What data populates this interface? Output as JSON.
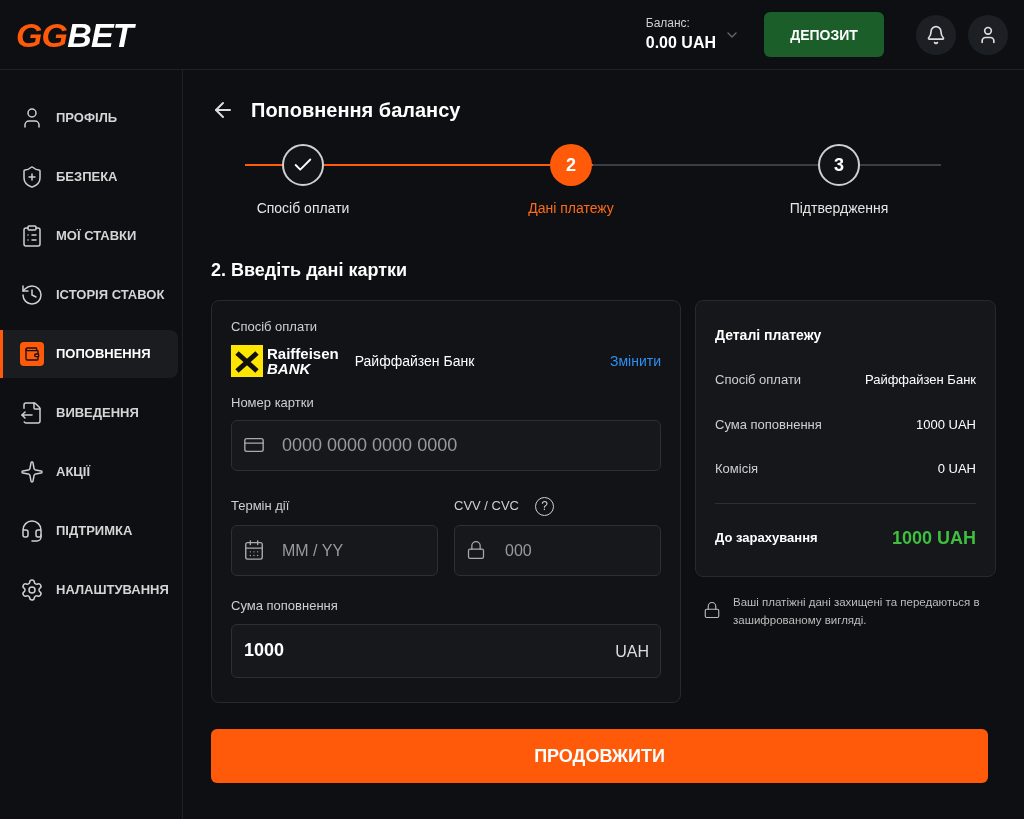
{
  "header": {
    "logo": {
      "accent": "GG",
      "rest": "BET"
    },
    "balance_label": "Баланс:",
    "balance": "0.00 UAH",
    "deposit_button": "ДЕПОЗИТ"
  },
  "sidebar": {
    "items": [
      {
        "label": "ПРОФІЛЬ",
        "selected": false
      },
      {
        "label": "БЕЗПЕКА",
        "selected": false
      },
      {
        "label": "МОЇ СТАВКИ",
        "selected": false
      },
      {
        "label": "ІСТОРІЯ СТАВОК",
        "selected": false
      },
      {
        "label": "ПОПОВНЕННЯ",
        "selected": true
      },
      {
        "label": "ВИВЕДЕННЯ",
        "selected": false
      },
      {
        "label": "АКЦІЇ",
        "selected": false
      },
      {
        "label": "ПІДТРИМКА",
        "selected": false
      },
      {
        "label": "НАЛАШТУВАННЯ",
        "selected": false
      }
    ]
  },
  "page_title": "Поповнення балансу",
  "steps": [
    {
      "kind": "done",
      "label": "Спосіб оплати"
    },
    {
      "kind": "current",
      "number": "2",
      "label": "Дані платежу"
    },
    {
      "kind": "pending",
      "number": "3",
      "label": "Підтвердження"
    }
  ],
  "section_title": "2. Введіть дані картки",
  "form": {
    "method_label": "Спосіб оплати",
    "bank_logo": {
      "line1": "Raiffeisen",
      "line2": "BANK"
    },
    "bank_name": "Райффайзен Банк",
    "change_link": "Змінити",
    "card_label": "Номер картки",
    "card_placeholder": "0000 0000 0000 0000",
    "expiry_label": "Термін дії",
    "expiry_placeholder": "MM / YY",
    "cvv_label": "CVV / CVC",
    "cvv_help": "?",
    "cvv_placeholder": "000",
    "amount_label": "Сума поповнення",
    "amount_value": "1000",
    "amount_currency": "UAH"
  },
  "details": {
    "title": "Деталі платежу",
    "rows": [
      {
        "label": "Спосіб оплати",
        "value": "Райффайзен Банк"
      },
      {
        "label": "Сума поповнення",
        "value": "1000 UAH"
      },
      {
        "label": "Комісія",
        "value": "0 UAH"
      }
    ],
    "total_label": "До зарахування",
    "total_value": "1000 UAH"
  },
  "security_note": "Ваші платіжні дані захищені та передаються в зашифрованому вигляді.",
  "continue_button": "ПРОДОВЖИТИ"
}
